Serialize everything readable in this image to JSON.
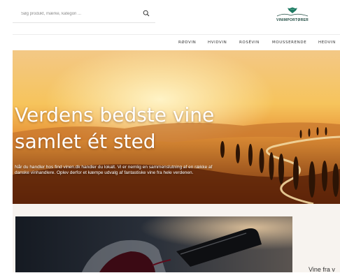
{
  "search": {
    "placeholder": "Søg produkt, mærke, kategori ..."
  },
  "logo": {
    "text": "VINIMPORTØRER"
  },
  "nav": {
    "items": [
      {
        "label": "RØDVIN"
      },
      {
        "label": "HVIDVIN"
      },
      {
        "label": "ROSÉVIN"
      },
      {
        "label": "MOUSSERENDE"
      },
      {
        "label": "HEDVIN"
      }
    ]
  },
  "hero": {
    "title_line1": "Verdens bedste vine",
    "title_line2": "samlet ét sted",
    "subtitle": "Når du handler hos find vinen.dk handler du lokalt. Vi er nemlig en sammenslutning af en række af danske vinhandlere. Oplev derfor et kæmpe udvalg af fantastiske vine fra hele verdenen."
  },
  "section": {
    "side_text": "Vine fra v"
  },
  "colors": {
    "logo_green": "#1e7a63",
    "nav_text": "#333333",
    "section_bg": "#f7f3ef"
  }
}
